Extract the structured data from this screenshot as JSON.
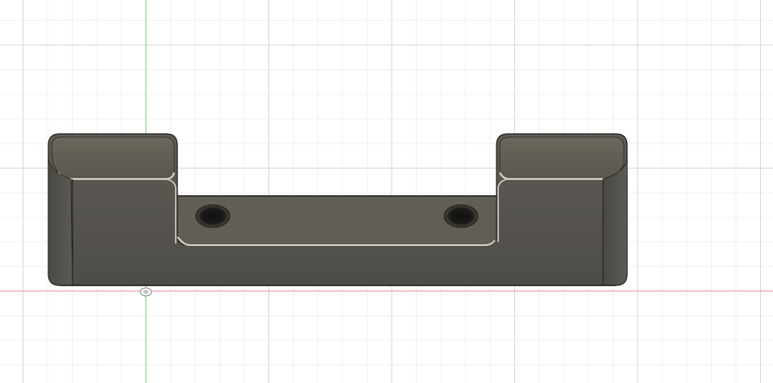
{
  "app": {
    "view": "cad-3d-viewport",
    "background_color": "#ffffff"
  },
  "grid": {
    "visible": true,
    "minor_line_color": "#ececec",
    "major_line_color": "#d6d6d6"
  },
  "axes": {
    "vertical_axis_color": "#8fd68f",
    "horizontal_axis_color": "#f0a0a0"
  },
  "model": {
    "name": "",
    "body_color": "#56544e",
    "face_color": "#6a665d",
    "top_face_color": "#5e5a50",
    "edge_color": "#1f1e1c",
    "highlight_color": "#d8d4c8",
    "hole_count": 2
  },
  "origin_marker": {
    "icon": "origin-point-icon"
  }
}
